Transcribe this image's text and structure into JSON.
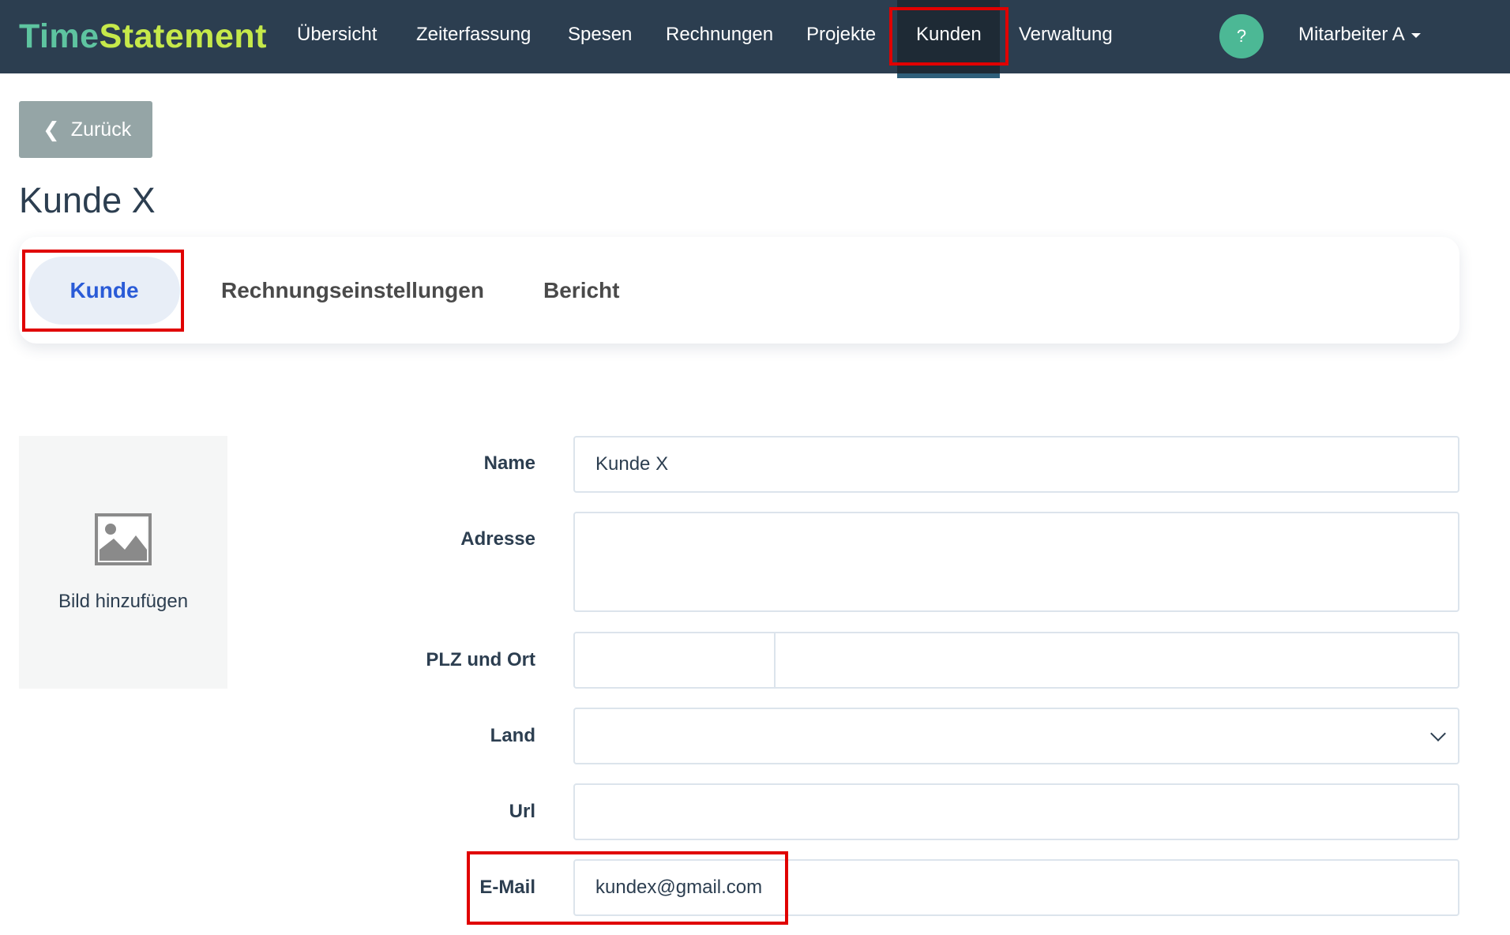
{
  "brand": {
    "part1": "Time",
    "part2": "Statement"
  },
  "nav": {
    "items": [
      "Übersicht",
      "Zeiterfassung",
      "Spesen",
      "Rechnungen",
      "Projekte",
      "Kunden",
      "Verwaltung"
    ],
    "active": "Kunden",
    "help_label": "?",
    "user_label": "Mitarbeiter A"
  },
  "back_label": "Zurück",
  "page_title": "Kunde X",
  "tabs": {
    "items": [
      "Kunde",
      "Rechnungseinstellungen",
      "Bericht"
    ],
    "active": "Kunde"
  },
  "image": {
    "label": "Bild hinzufügen",
    "icon": "image-icon"
  },
  "form": {
    "name_label": "Name",
    "name_value": "Kunde X",
    "address_label": "Adresse",
    "address_value": "",
    "plz_label": "PLZ und Ort",
    "plz_value": "",
    "ort_value": "",
    "land_label": "Land",
    "land_value": "",
    "url_label": "Url",
    "url_value": "",
    "email_label": "E-Mail",
    "email_value": "kundex@gmail.com"
  },
  "colors": {
    "navbar": "#2c3e50",
    "brand_time": "#5ec4a0",
    "brand_statement": "#c6e94a",
    "active_tab_text": "#2a5bd7",
    "highlight": "#e00000"
  }
}
